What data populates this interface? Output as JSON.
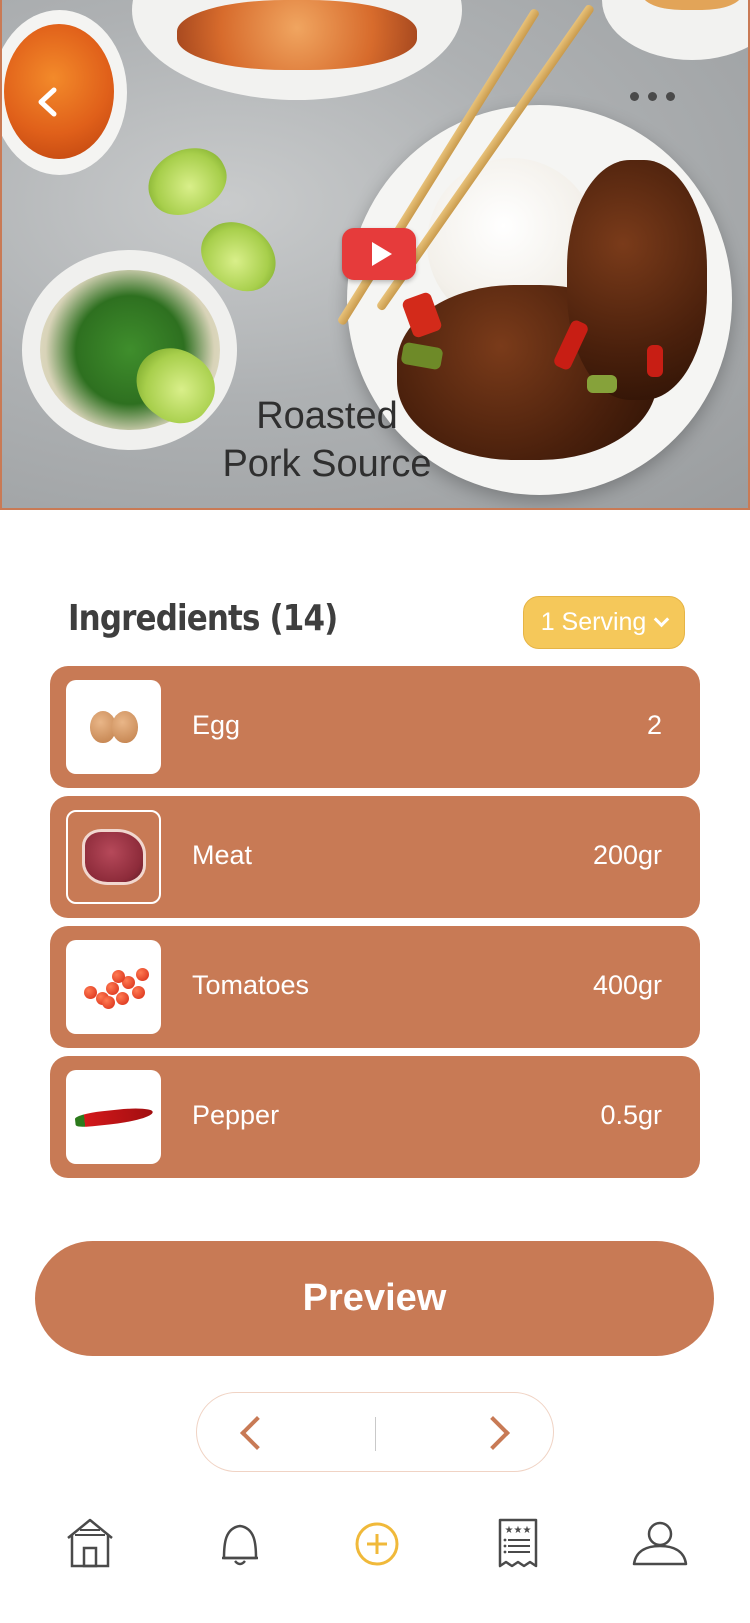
{
  "hero": {
    "title": "Roasted\nPork Source",
    "back_icon": "chevron-left-icon",
    "more_icon": "more-horizontal-icon",
    "play_icon": "youtube-play-icon"
  },
  "ingredients": {
    "heading": "Ingredients  (14)",
    "serving_label": "1 Serving",
    "items": [
      {
        "name": "Egg",
        "quantity": "2",
        "image": "eggs"
      },
      {
        "name": "Meat",
        "quantity": "200gr",
        "image": "meat"
      },
      {
        "name": "Tomatoes",
        "quantity": "400gr",
        "image": "cherry-tomatoes"
      },
      {
        "name": "Pepper",
        "quantity": "0.5gr",
        "image": "chili-pepper"
      }
    ]
  },
  "preview_button": {
    "label": "Preview"
  },
  "pager": {
    "prev_icon": "chevron-left-icon",
    "next_icon": "chevron-right-icon"
  },
  "bottom_nav": [
    {
      "name": "home",
      "icon": "home-icon"
    },
    {
      "name": "notifications",
      "icon": "bell-icon"
    },
    {
      "name": "add",
      "icon": "plus-circle-icon",
      "active": true
    },
    {
      "name": "recipes",
      "icon": "recipe-list-icon"
    },
    {
      "name": "profile",
      "icon": "user-icon"
    }
  ],
  "colors": {
    "accent": "#c87a55",
    "serving_badge": "#f5c85a",
    "active_nav": "#f0b93a",
    "play_button": "#e63b3b"
  }
}
